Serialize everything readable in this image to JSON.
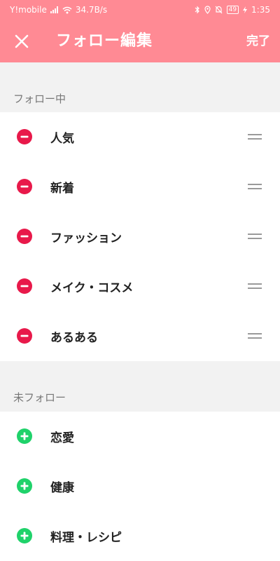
{
  "status_bar": {
    "carrier": "Y!mobile",
    "speed": "34.7B/s",
    "battery": "49",
    "time": "1:35"
  },
  "header": {
    "title": "フォロー編集",
    "done_label": "完了"
  },
  "following": {
    "heading": "フォロー中",
    "items": [
      {
        "label": "人気"
      },
      {
        "label": "新着"
      },
      {
        "label": "ファッション"
      },
      {
        "label": "メイク・コスメ"
      },
      {
        "label": "あるある"
      }
    ]
  },
  "not_following": {
    "heading": "未フォロー",
    "items": [
      {
        "label": "恋愛"
      },
      {
        "label": "健康"
      },
      {
        "label": "料理・レシピ"
      }
    ]
  },
  "colors": {
    "header_bg": "#ff8a94",
    "remove": "#e8194a",
    "add": "#1fd26a",
    "background": "#f2f2f2"
  },
  "icons": {
    "close": "close-icon",
    "remove": "minus-circle-icon",
    "add": "plus-circle-icon",
    "drag": "drag-handle-icon"
  }
}
